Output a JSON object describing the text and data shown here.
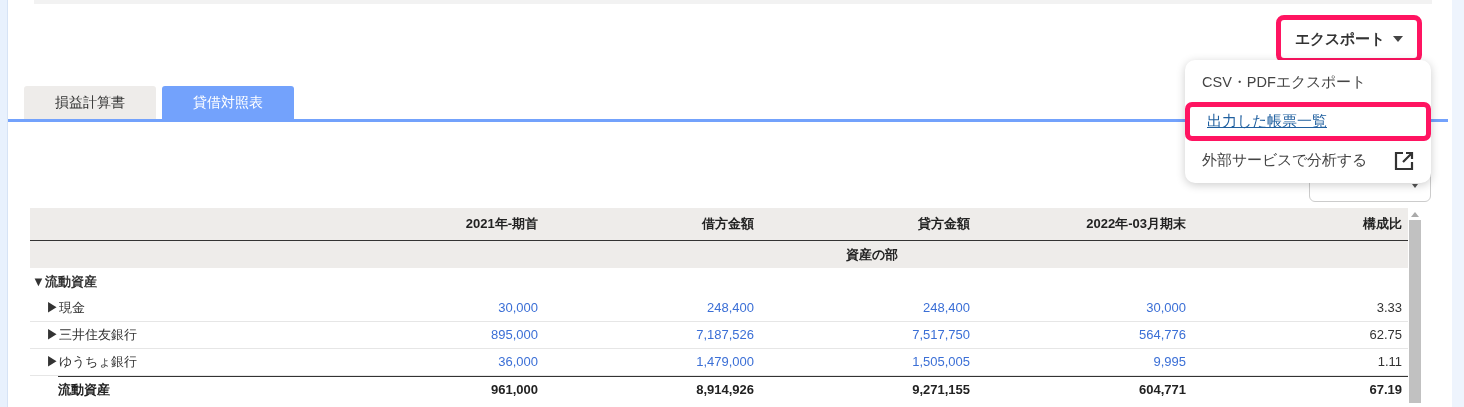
{
  "export_button": {
    "label": "エクスポート",
    "highlighted": true
  },
  "export_menu": {
    "items": [
      {
        "label": "CSV・PDFエクスポート",
        "kind": "plain",
        "highlighted": false
      },
      {
        "label": "出力した帳票一覧",
        "kind": "link",
        "highlighted": true
      },
      {
        "label": "外部サービスで分析する",
        "kind": "external",
        "highlighted": false
      }
    ]
  },
  "tabs": [
    {
      "label": "損益計算書",
      "selected": false
    },
    {
      "label": "貸借対照表",
      "selected": true
    }
  ],
  "table": {
    "columns": [
      "2021年-期首",
      "借方金額",
      "貸方金額",
      "2022年-03月期末",
      "構成比"
    ],
    "section": "資産の部",
    "rows": [
      {
        "kind": "group",
        "label": "▼流動資産",
        "cells": []
      },
      {
        "kind": "item",
        "label": "▶現金",
        "cells": [
          "30,000",
          "248,400",
          "248,400",
          "30,000",
          "3.33"
        ]
      },
      {
        "kind": "item",
        "label": "▶三井住友銀行",
        "cells": [
          "895,000",
          "7,187,526",
          "7,517,750",
          "564,776",
          "62.75"
        ]
      },
      {
        "kind": "item",
        "label": "▶ゆうちょ銀行",
        "cells": [
          "36,000",
          "1,479,000",
          "1,505,005",
          "9,995",
          "1.11"
        ]
      },
      {
        "kind": "total",
        "label": "流動資産",
        "cells": [
          "961,000",
          "8,914,926",
          "9,271,155",
          "604,771",
          "67.19"
        ]
      }
    ]
  }
}
